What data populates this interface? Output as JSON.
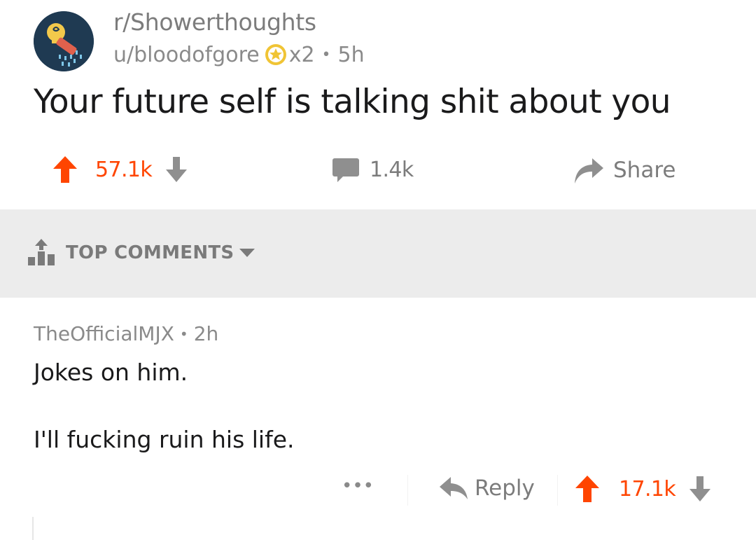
{
  "post": {
    "subreddit": "r/Showerthoughts",
    "author": "u/bloodofgore",
    "award_count": "x2",
    "separator": "•",
    "age": "5h",
    "title": "Your future self is talking shit about you",
    "upvotes": "57.1k",
    "comments": "1.4k",
    "share_label": "Share",
    "icons": {
      "avatar": "showerhead-lightbulb-avatar",
      "award": "silver-award-icon",
      "upvote": "upvote-arrow-icon",
      "downvote": "downvote-arrow-icon",
      "comment": "comment-bubble-icon",
      "share": "share-arrow-icon"
    }
  },
  "sort": {
    "label": "TOP COMMENTS",
    "icon": "top-sort-icon",
    "caret": "caret-down-icon"
  },
  "comment": {
    "author": "TheOfficialMJX",
    "separator": "•",
    "age": "2h",
    "body_line1": "Jokes on him.",
    "body_line2": "I'll fucking ruin his life.",
    "more_label": "•••",
    "reply_label": "Reply",
    "upvotes": "17.1k"
  },
  "colors": {
    "upvote": "#ff4500",
    "muted": "#7c7c7c",
    "sort_bg": "#ececec",
    "text": "#1a1a1b"
  }
}
